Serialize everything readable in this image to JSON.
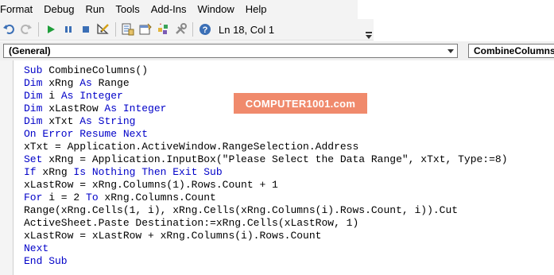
{
  "menu": [
    "Format",
    "Debug",
    "Run",
    "Tools",
    "Add-Ins",
    "Window",
    "Help"
  ],
  "toolbar": {
    "buttons": [
      {
        "name": "undo-icon"
      },
      {
        "name": "redo-icon"
      },
      {
        "name": "run-icon"
      },
      {
        "name": "break-icon"
      },
      {
        "name": "reset-icon"
      },
      {
        "name": "design-mode-icon"
      },
      {
        "name": "project-explorer-icon"
      },
      {
        "name": "properties-window-icon"
      },
      {
        "name": "object-browser-icon"
      },
      {
        "name": "toolbox-icon"
      },
      {
        "name": "help-icon"
      }
    ],
    "status": "Ln 18, Col 1"
  },
  "combos": {
    "object": "(General)",
    "procedure": "CombineColumns"
  },
  "watermark": "COMPUTER1001.com",
  "colors": {
    "keyword": "#0000c8",
    "watermark_bg": "#f08a6c",
    "run_green": "#1f9e3a",
    "toolbar_bg": "#f3f3f3"
  },
  "code": [
    [
      {
        "t": "Sub",
        "k": true
      },
      {
        "t": " CombineColumns()"
      }
    ],
    [
      {
        "t": "Dim",
        "k": true
      },
      {
        "t": " xRng "
      },
      {
        "t": "As",
        "k": true
      },
      {
        "t": " Range"
      }
    ],
    [
      {
        "t": "Dim",
        "k": true
      },
      {
        "t": " i "
      },
      {
        "t": "As",
        "k": true
      },
      {
        "t": " "
      },
      {
        "t": "Integer",
        "k": true
      }
    ],
    [
      {
        "t": "Dim",
        "k": true
      },
      {
        "t": " xLastRow "
      },
      {
        "t": "As",
        "k": true
      },
      {
        "t": " "
      },
      {
        "t": "Integer",
        "k": true
      }
    ],
    [
      {
        "t": "Dim",
        "k": true
      },
      {
        "t": " xTxt "
      },
      {
        "t": "As",
        "k": true
      },
      {
        "t": " "
      },
      {
        "t": "String",
        "k": true
      }
    ],
    [
      {
        "t": "On Error Resume Next",
        "k": true
      }
    ],
    [
      {
        "t": "xTxt = Application.ActiveWindow.RangeSelection.Address"
      }
    ],
    [
      {
        "t": "Set",
        "k": true
      },
      {
        "t": " xRng = Application.InputBox(\"Please Select the Data Range\", xTxt, Type:=8)"
      }
    ],
    [
      {
        "t": "If",
        "k": true
      },
      {
        "t": " xRng "
      },
      {
        "t": "Is Nothing Then Exit Sub",
        "k": true
      }
    ],
    [
      {
        "t": "xLastRow = xRng.Columns(1).Rows.Count + 1"
      }
    ],
    [
      {
        "t": "For",
        "k": true
      },
      {
        "t": " i = 2 "
      },
      {
        "t": "To",
        "k": true
      },
      {
        "t": " xRng.Columns.Count"
      }
    ],
    [
      {
        "t": "Range(xRng.Cells(1, i), xRng.Cells(xRng.Columns(i).Rows.Count, i)).Cut"
      }
    ],
    [
      {
        "t": "ActiveSheet.Paste Destination:=xRng.Cells(xLastRow, 1)"
      }
    ],
    [
      {
        "t": "xLastRow = xLastRow + xRng.Columns(i).Rows.Count"
      }
    ],
    [
      {
        "t": "Next",
        "k": true
      }
    ],
    [
      {
        "t": "End Sub",
        "k": true
      }
    ]
  ]
}
